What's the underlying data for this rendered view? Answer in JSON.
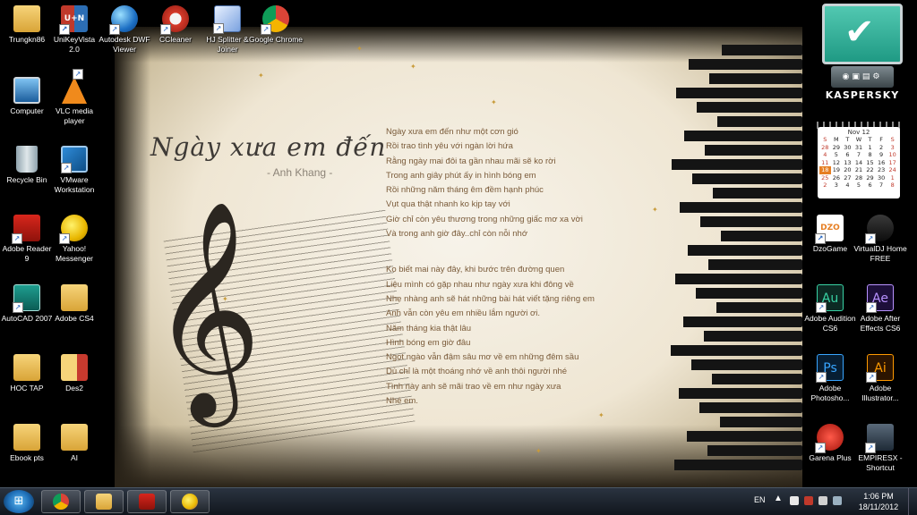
{
  "wallpaper": {
    "title": "Ngày xưa em đến",
    "author": "- Anh Khang -",
    "stanza1": [
      "Ngày xưa em đến như một cơn gió",
      "Rồi trao tình yêu  với ngàn lời hứa",
      "Rằng ngày mai đôi ta gần nhau mãi sẽ ko rời",
      "Trong anh giây phút ấy in hình bóng em",
      "Rồi những năm tháng êm đềm hạnh phúc",
      "Vụt qua thật nhanh ko kịp tay với",
      "Giờ chỉ còn yêu thương trong những giấc mơ xa vời",
      "Và trong anh giờ đây..chỉ còn nỗi nhớ"
    ],
    "stanza2": [
      "Ko biết mai này đây, khi bước trên đường quen",
      "Liệu mình có gặp nhau như ngày xưa khi đông về",
      "Nhẹ nhàng anh sẽ hát những bài hát viết tặng riêng em",
      "Anh vẫn còn yêu em nhiều lắm người ơi.",
      "Năm tháng kia thật lâu",
      "Hình bóng em giờ đâu",
      "Ngọt ngào vẫn đậm sâu mơ về em những đêm sầu",
      "Dù chỉ là một thoáng nhớ về anh thôi người nhé",
      "Tình này anh sẽ mãi trao về em như ngày xưa",
      "Nhé em."
    ]
  },
  "desktop_icons": [
    {
      "id": "trungkn86",
      "label": "Trungkn86"
    },
    {
      "id": "unikey",
      "label": "UniKeyVista 2.0"
    },
    {
      "id": "autodesk",
      "label": "Autodesk DWF Viewer"
    },
    {
      "id": "ccleaner",
      "label": "CCleaner"
    },
    {
      "id": "hjsplit",
      "label": "HJ Splitter & Joiner"
    },
    {
      "id": "chrome",
      "label": "Google Chrome"
    },
    {
      "id": "computer",
      "label": "Computer"
    },
    {
      "id": "vlc",
      "label": "VLC media player"
    },
    {
      "id": "recycle",
      "label": "Recycle Bin"
    },
    {
      "id": "vmware",
      "label": "VMware Workstation"
    },
    {
      "id": "adobe_reader",
      "label": "Adobe Reader 9"
    },
    {
      "id": "yahoo",
      "label": "Yahoo! Messenger"
    },
    {
      "id": "autocad",
      "label": "AutoCAD 2007"
    },
    {
      "id": "adobe_cs4",
      "label": "Adobe CS4"
    },
    {
      "id": "hoc_tap",
      "label": "HOC TAP"
    },
    {
      "id": "des2",
      "label": "Des2"
    },
    {
      "id": "ebook",
      "label": "Ebook pts"
    },
    {
      "id": "ai_folder",
      "label": "AI"
    },
    {
      "id": "dzogame",
      "label": "DzoGame"
    },
    {
      "id": "virtualdj",
      "label": "VirtualDJ Home FREE"
    },
    {
      "id": "audition",
      "label": "Adobe Audition CS6"
    },
    {
      "id": "aftereffects",
      "label": "Adobe After Effects CS6"
    },
    {
      "id": "photoshop",
      "label": "Adobe Photosho..."
    },
    {
      "id": "illustrator",
      "label": "Adobe Illustrator..."
    },
    {
      "id": "garena",
      "label": "Garena Plus"
    },
    {
      "id": "empiresx",
      "label": "EMPIRESX - Shortcut"
    }
  ],
  "icon_glyphs": {
    "unikey": "U+N",
    "audition": "Au",
    "aftereffects": "Ae",
    "photoshop": "Ps",
    "illustrator": "Ai",
    "dzogame": "DZO"
  },
  "kaspersky": {
    "brand": "KASPERSKY"
  },
  "calendar": {
    "month_label": "Nov 12",
    "weekdays": [
      "S",
      "M",
      "T",
      "W",
      "T",
      "F",
      "S"
    ],
    "weeks": [
      [
        "28",
        "29",
        "30",
        "31",
        "1",
        "2",
        "3"
      ],
      [
        "4",
        "5",
        "6",
        "7",
        "8",
        "9",
        "10"
      ],
      [
        "11",
        "12",
        "13",
        "14",
        "15",
        "16",
        "17"
      ],
      [
        "18",
        "19",
        "20",
        "21",
        "22",
        "23",
        "24"
      ],
      [
        "25",
        "26",
        "27",
        "28",
        "29",
        "30",
        "1"
      ],
      [
        "2",
        "3",
        "4",
        "5",
        "6",
        "7",
        "8"
      ]
    ],
    "today": "18"
  },
  "taskbar": {
    "pinned": [
      "chrome",
      "explorer",
      "adobe-reader",
      "yahoo-messenger"
    ],
    "language": "EN",
    "time": "1:06 PM",
    "date": "18/11/2012"
  },
  "colors": {
    "taskbar": "#1b222b",
    "poem_text": "#7a5b3a",
    "accent_star": "#c89b3a"
  }
}
